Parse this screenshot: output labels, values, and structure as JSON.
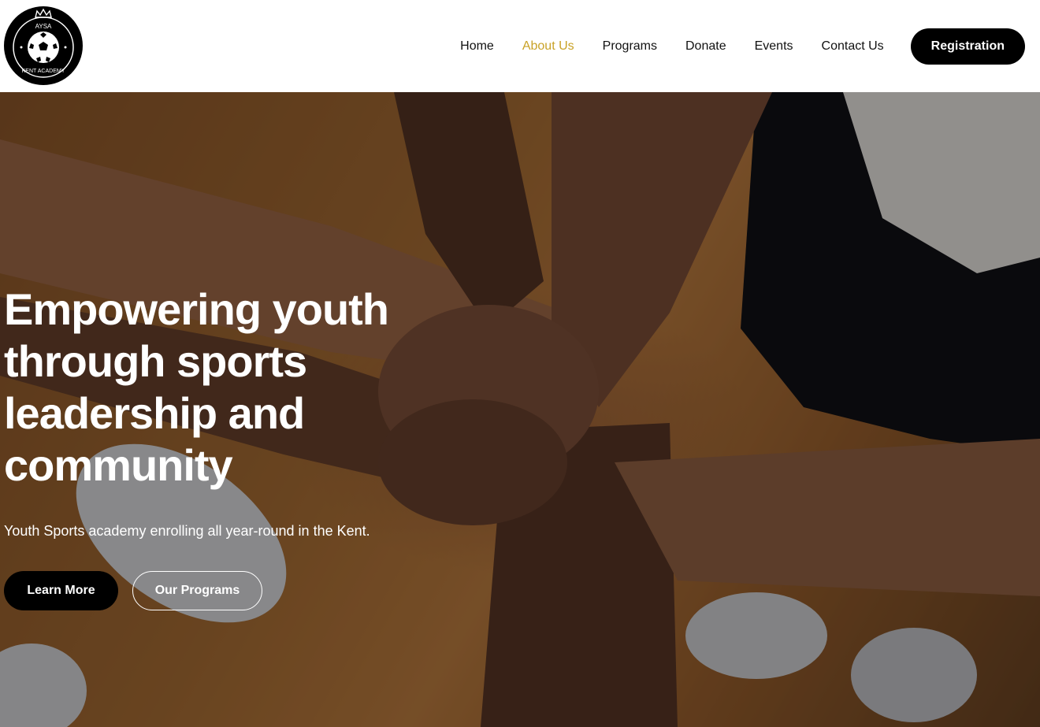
{
  "logo": {
    "top_text": "AYSA",
    "bottom_text": "KENT ACADEMY"
  },
  "nav": {
    "items": [
      {
        "label": "Home",
        "active": false
      },
      {
        "label": "About Us",
        "active": true
      },
      {
        "label": "Programs",
        "active": false
      },
      {
        "label": "Donate",
        "active": false
      },
      {
        "label": "Events",
        "active": false
      },
      {
        "label": "Contact Us",
        "active": false
      }
    ],
    "register_label": "Registration"
  },
  "hero": {
    "title_lines": [
      "Empowering youth",
      "through sports",
      "leadership and",
      "community"
    ],
    "subtitle": "Youth Sports academy enrolling all year-round in the Kent.",
    "learn_more_label": "Learn More",
    "our_programs_label": "Our Programs",
    "image_description_icon": "hands-stacked-photo"
  },
  "colors": {
    "accent": "#c9a227",
    "dark": "#000000",
    "text_on_hero": "#ffffff"
  }
}
